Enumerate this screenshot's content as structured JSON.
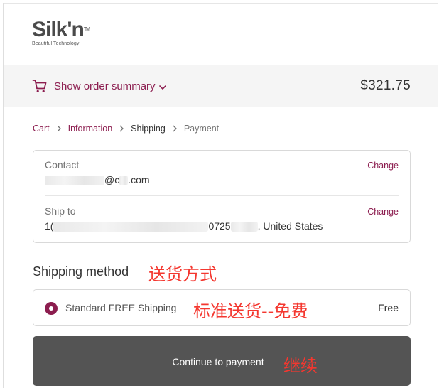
{
  "brand": {
    "logo_text": "Silk'n",
    "logo_tm": "TM",
    "tagline": "Beautiful Technology"
  },
  "order_summary": {
    "toggle_label": "Show order summary",
    "total": "$321.75",
    "icons": {
      "cart": "cart-icon",
      "chevron": "chevron-down-icon"
    },
    "accent_color": "#8c1d4f"
  },
  "breadcrumb": {
    "items": [
      "Cart",
      "Information",
      "Shipping",
      "Payment"
    ],
    "current": "Shipping"
  },
  "review": {
    "contact": {
      "label": "Contact",
      "value_mid": "@c",
      "value_end": ".com",
      "change_label": "Change"
    },
    "ship_to": {
      "label": "Ship to",
      "value_start": "1(",
      "value_mid": "0725",
      "value_end": ", United States",
      "change_label": "Change"
    }
  },
  "shipping_method": {
    "title": "Shipping method",
    "option_name": "Standard FREE Shipping",
    "option_price": "Free",
    "selected": true
  },
  "annotations": {
    "method_title": "送货方式",
    "method_option": "标准送货--免费",
    "continue": "继续",
    "color": "#f4372f"
  },
  "actions": {
    "continue_label": "Continue to payment",
    "button_color": "#545454"
  }
}
